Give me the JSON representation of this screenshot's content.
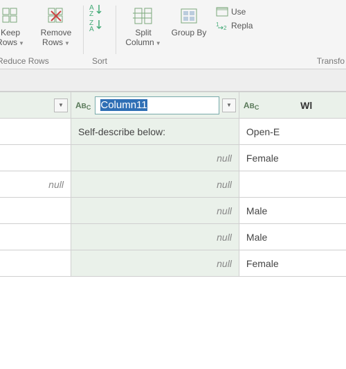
{
  "ribbon": {
    "keep_rows": "Keep Rows",
    "remove_rows": "Remove Rows",
    "split_column": "Split Column",
    "group_by": "Group By",
    "use": "Use",
    "replace": "Repla",
    "group_reduce": "Reduce Rows",
    "group_sort": "Sort",
    "group_transform": "Transfo"
  },
  "headers": {
    "col_b_edit_value": "Column11",
    "col_c_label": "Wl"
  },
  "rows": [
    {
      "a": "",
      "b": "Self-describe below:",
      "b_null": false,
      "c": "Open-E"
    },
    {
      "a": "",
      "b": "null",
      "b_null": true,
      "c": "Female"
    },
    {
      "a": "null",
      "a_null": true,
      "b": "null",
      "b_null": true,
      "c": ""
    },
    {
      "a": "",
      "b": "null",
      "b_null": true,
      "c": "Male"
    },
    {
      "a": "",
      "b": "null",
      "b_null": true,
      "c": "Male"
    },
    {
      "a": "",
      "b": "null",
      "b_null": true,
      "c": "Female"
    }
  ]
}
